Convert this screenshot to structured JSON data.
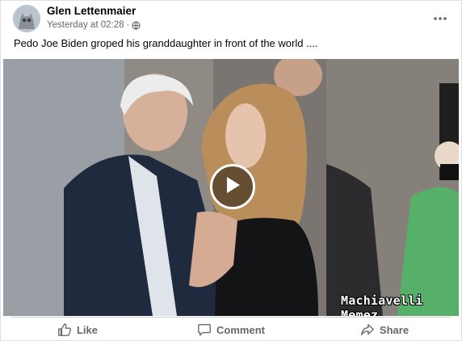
{
  "post": {
    "author": "Glen Lettenmaier",
    "timestamp": "Yesterday at 02:28",
    "separator": "·",
    "audience_icon": "globe-icon",
    "text": "Pedo Joe Biden groped his granddaughter in front of the world ...."
  },
  "video": {
    "watermark": "Machiavelli Memez",
    "play_icon": "play-icon"
  },
  "actions": {
    "like": "Like",
    "comment": "Comment",
    "share": "Share"
  },
  "colors": {
    "secondary_text": "#65676b",
    "divider": "#ced0d4"
  }
}
